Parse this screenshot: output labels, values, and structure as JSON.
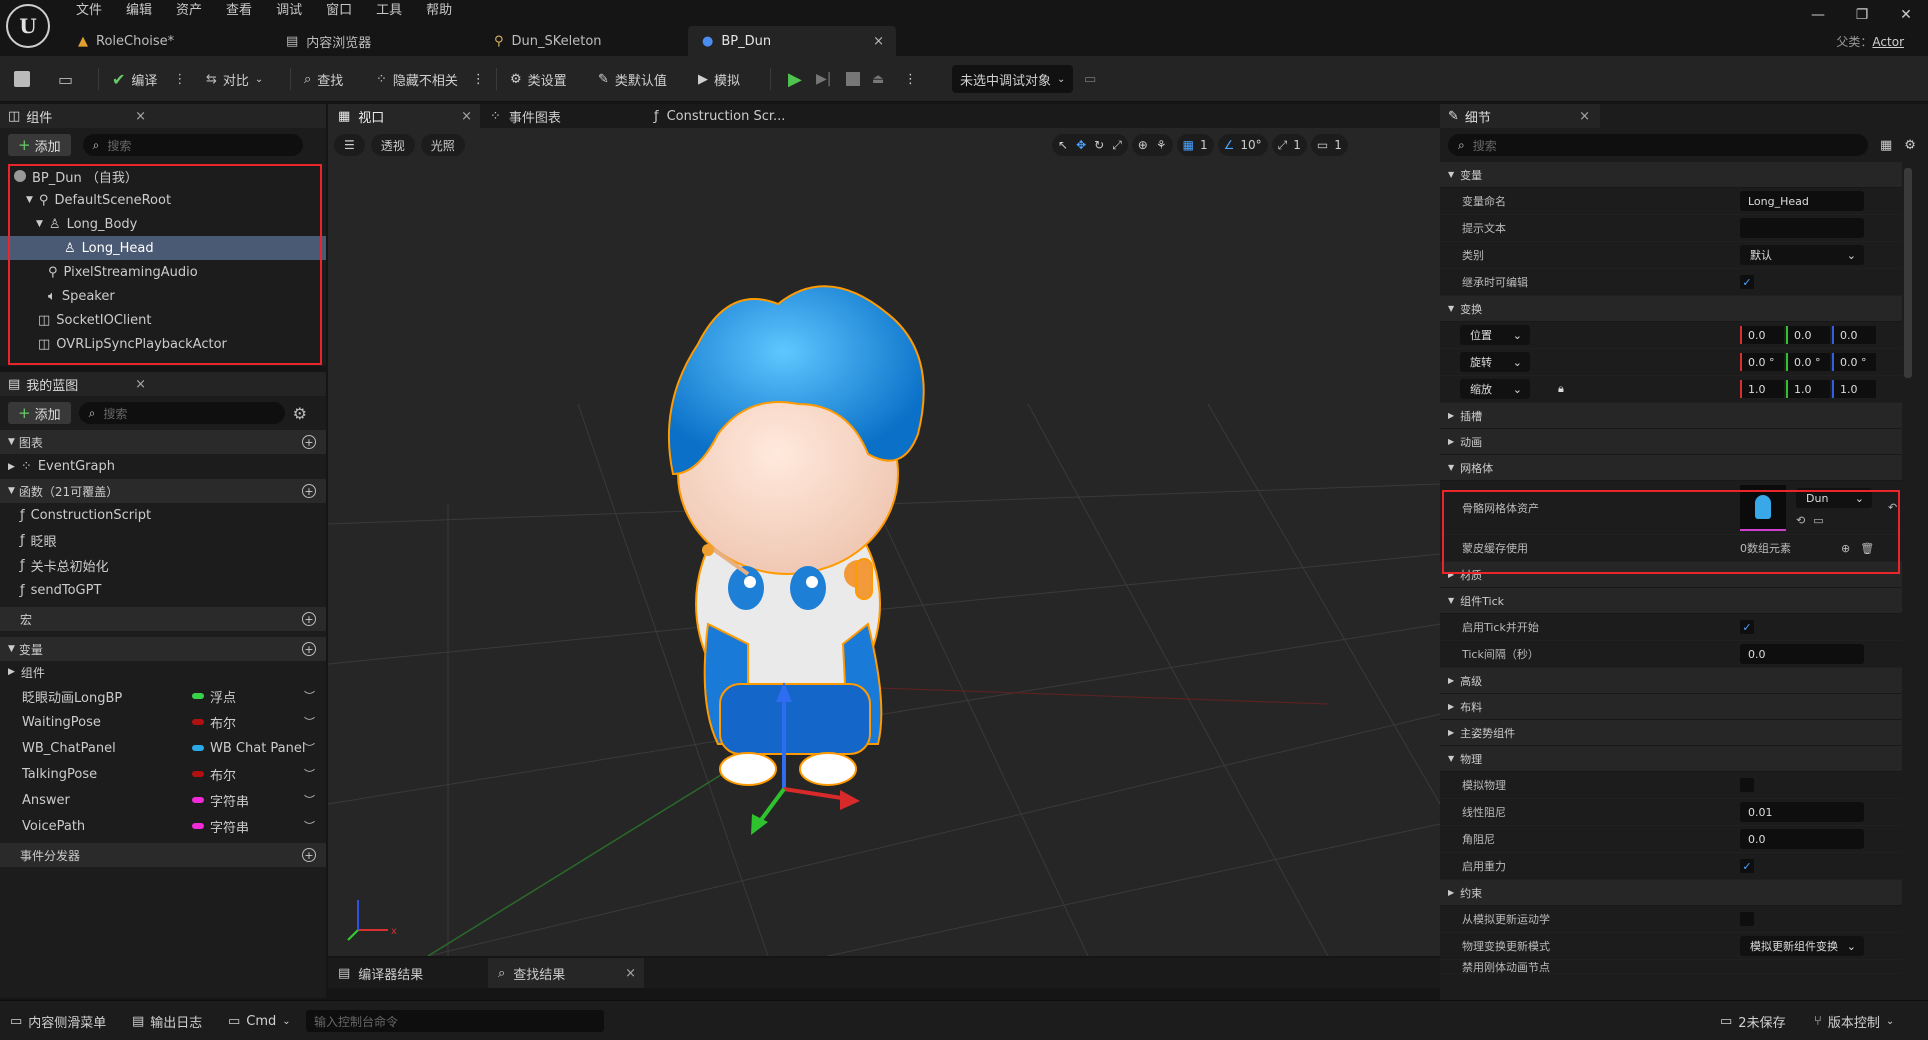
{
  "menu": [
    "文件",
    "编辑",
    "资产",
    "查看",
    "调试",
    "窗口",
    "工具",
    "帮助"
  ],
  "tabs": [
    {
      "label": "RoleChoise*"
    },
    {
      "label": "内容浏览器"
    },
    {
      "label": "Dun_SKeleton"
    },
    {
      "label": "BP_Dun"
    }
  ],
  "parent": {
    "label": "父类：",
    "value": "Actor"
  },
  "toolbar": {
    "compile": "编译",
    "diff": "对比",
    "find": "查找",
    "hide_unrelated": "隐藏不相关",
    "class_settings": "类设置",
    "class_defaults": "类默认值",
    "simulate": "模拟",
    "debug_target": "未选中调试对象"
  },
  "components": {
    "title": "组件",
    "add": "添加",
    "search_placeholder": "搜索",
    "items": [
      {
        "label": "BP_Dun （自我）",
        "indent": 0
      },
      {
        "label": "DefaultSceneRoot",
        "indent": 1
      },
      {
        "label": "Long_Body",
        "indent": 2
      },
      {
        "label": "Long_Head",
        "indent": 3,
        "selected": true
      },
      {
        "label": "PixelStreamingAudio",
        "indent": 2
      },
      {
        "label": "Speaker",
        "indent": 2
      },
      {
        "label": "SocketIOClient",
        "indent": 1
      },
      {
        "label": "OVRLipSyncPlaybackActor",
        "indent": 1
      }
    ]
  },
  "myblueprint": {
    "title": "我的蓝图",
    "add": "添加",
    "search_placeholder": "搜索",
    "graphs_label": "图表",
    "event_graph": "EventGraph",
    "functions_label": "函数（21可覆盖）",
    "functions": [
      "ConstructionScript",
      "眨眼",
      "关卡总初始化",
      "sendToGPT"
    ],
    "macros_label": "宏",
    "variables_label": "变量",
    "components_label": "组件",
    "variables": [
      {
        "name": "眨眼动画LongBP",
        "type": "浮点",
        "color": "#39d14a"
      },
      {
        "name": "WaitingPose",
        "type": "布尔",
        "color": "#b01010"
      },
      {
        "name": "WB_ChatPanel",
        "type": "WB Chat Panel",
        "color": "#2aa8e8"
      },
      {
        "name": "TalkingPose",
        "type": "布尔",
        "color": "#b01010"
      },
      {
        "name": "Answer",
        "type": "字符串",
        "color": "#ee2bd6"
      },
      {
        "name": "VoicePath",
        "type": "字符串",
        "color": "#ee2bd6"
      }
    ],
    "dispatchers_label": "事件分发器"
  },
  "viewport": {
    "tabs": [
      "视口",
      "事件图表",
      "Construction Scr..."
    ],
    "perspective": "透视",
    "lit": "光照",
    "grid": "1",
    "angle": "10°",
    "scale": "1",
    "camera": "1"
  },
  "details": {
    "title": "细节",
    "search_placeholder": "搜索",
    "variable_section": "变量",
    "var_name_label": "变量命名",
    "var_name": "Long_Head",
    "tooltip_label": "提示文本",
    "category_label": "类别",
    "category": "默认",
    "editable_label": "继承时可编辑",
    "transform_section": "变换",
    "location": "位置",
    "rotation": "旋转",
    "scale": "缩放",
    "loc": [
      "0.0",
      "0.0",
      "0.0"
    ],
    "rot": [
      "0.0 °",
      "0.0 °",
      "0.0 °"
    ],
    "scl": [
      "1.0",
      "1.0",
      "1.0"
    ],
    "sockets": "插槽",
    "animation": "动画",
    "mesh_section": "网格体",
    "skel_mesh_label": "骨骼网格体资产",
    "skel_mesh": "Dun",
    "skin_cache_label": "蒙皮缓存使用",
    "skin_cache": "0数组元素",
    "materials": "材质",
    "comp_tick": "组件Tick",
    "tick_start_label": "启用Tick并开始",
    "tick_interval_label": "Tick间隔（秒）",
    "tick_interval": "0.0",
    "advanced": "高级",
    "cloth": "布料",
    "master_pose": "主姿势组件",
    "physics": "物理",
    "simulate_physics": "模拟物理",
    "linear_damping_label": "线性阻尼",
    "linear_damping": "0.01",
    "angular_damping_label": "角阻尼",
    "angular_damping": "0.0",
    "gravity_label": "启用重力",
    "constraints": "约束",
    "update_kinematic_label": "从模拟更新运动学",
    "phys_transform_label": "物理变换更新模式",
    "phys_transform": "模拟更新组件变换",
    "disable_rb_label": "禁用刚体动画节点"
  },
  "bottom_tabs": {
    "compiler": "编译器结果",
    "find": "查找结果"
  },
  "statusbar": {
    "drawer": "内容侧滑菜单",
    "output_log": "输出日志",
    "cmd": "Cmd",
    "console_placeholder": "输入控制台命令",
    "unsaved": "2未保存",
    "source_control": "版本控制"
  }
}
